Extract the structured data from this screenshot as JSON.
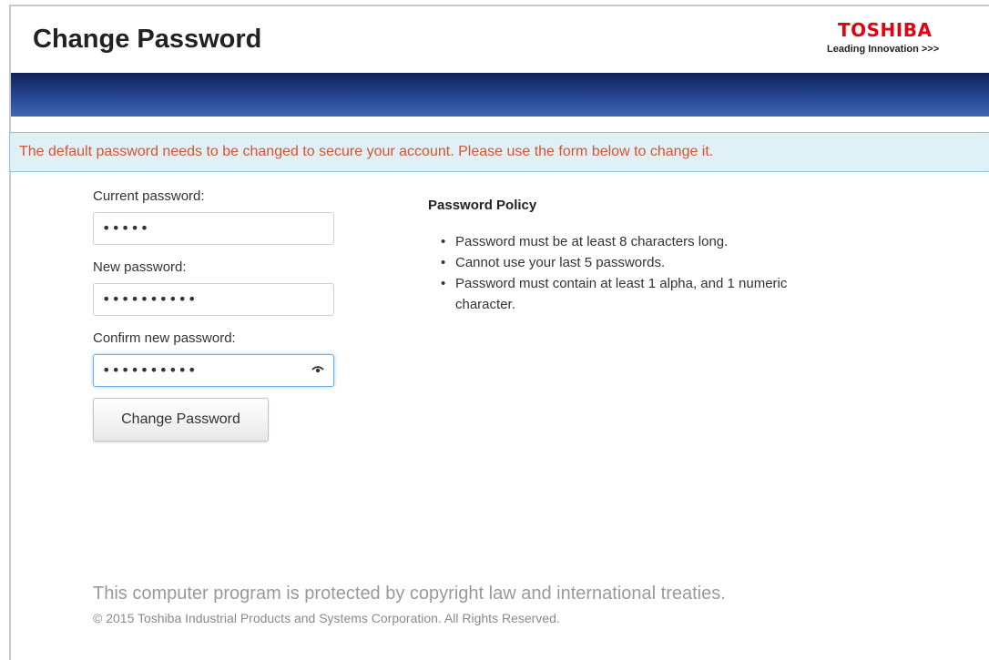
{
  "header": {
    "title": "Change Password",
    "logo_text": "TOSHIBA",
    "logo_tagline": "Leading Innovation >>>"
  },
  "alert": {
    "message": "The default password needs to be changed to secure your account. Please use the form below to change it."
  },
  "form": {
    "current_label": "Current password:",
    "current_value": "•••••",
    "new_label": "New password:",
    "new_value": "••••••••••",
    "confirm_label": "Confirm new password:",
    "confirm_value": "••••••••••",
    "submit_label": "Change Password"
  },
  "policy": {
    "title": "Password Policy",
    "items": [
      "Password must be at least 8 characters long.",
      "Cannot use your last 5 passwords.",
      "Password must contain at least 1 alpha, and 1 numeric character."
    ]
  },
  "footer": {
    "notice": "This computer program is protected by copyright law and international treaties.",
    "copyright": "© 2015 Toshiba Industrial Products and Systems Corporation. All Rights Reserved."
  },
  "colors": {
    "brand_red": "#e60012",
    "header_bar": "#1c3577",
    "alert_text": "#d9532e",
    "alert_bg": "#dff0f7"
  },
  "icons": {
    "reveal_password": "eye-icon"
  }
}
